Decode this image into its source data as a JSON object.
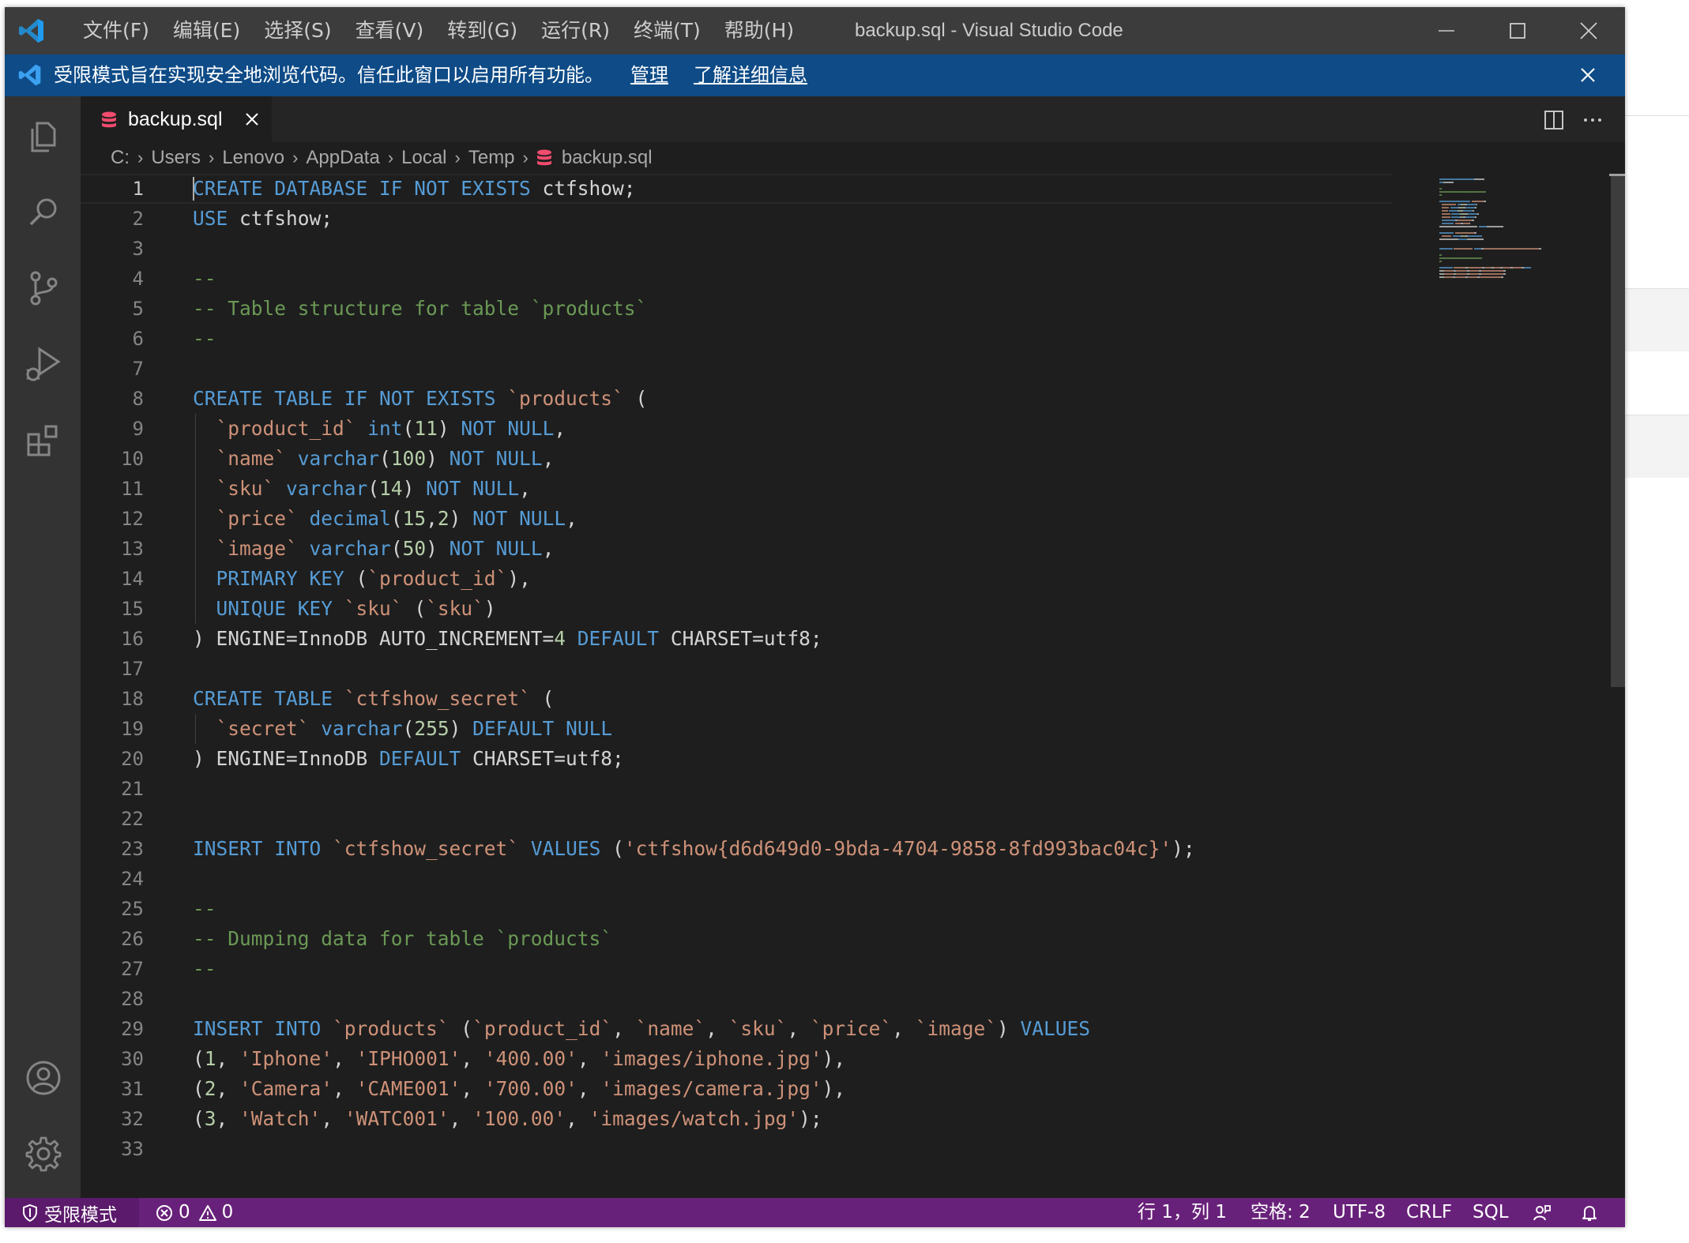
{
  "window": {
    "title": "backup.sql - Visual Studio Code",
    "menu": [
      "文件(F)",
      "编辑(E)",
      "选择(S)",
      "查看(V)",
      "转到(G)",
      "运行(R)",
      "终端(T)",
      "帮助(H)"
    ]
  },
  "banner": {
    "text": "受限模式旨在实现安全地浏览代码。信任此窗口以启用所有功能。",
    "manage_link": "管理",
    "learn_more_link": "了解详细信息"
  },
  "activity_bar": {
    "icons": [
      "explorer-icon",
      "search-icon",
      "source-control-icon",
      "run-debug-icon",
      "extensions-icon",
      "accounts-icon",
      "settings-gear-icon"
    ]
  },
  "tab": {
    "label": "backup.sql"
  },
  "breadcrumb": [
    "C:",
    "Users",
    "Lenovo",
    "AppData",
    "Local",
    "Temp",
    "backup.sql"
  ],
  "editor": {
    "line_numbers": [
      "1",
      "2",
      "3",
      "4",
      "5",
      "6",
      "7",
      "8",
      "9",
      "10",
      "11",
      "12",
      "13",
      "14",
      "15",
      "16",
      "17",
      "18",
      "19",
      "20",
      "21",
      "22",
      "23",
      "24",
      "25",
      "26",
      "27",
      "28",
      "29",
      "30",
      "31",
      "32",
      "33"
    ],
    "lines": [
      [
        [
          "kw",
          "CREATE DATABASE IF NOT EXISTS"
        ],
        [
          "tx",
          " ctfshow;"
        ]
      ],
      [
        [
          "kw",
          "USE"
        ],
        [
          "tx",
          " ctfshow;"
        ]
      ],
      [],
      [
        [
          "cm",
          "--"
        ]
      ],
      [
        [
          "cm",
          "-- Table structure for table `products`"
        ]
      ],
      [
        [
          "cm",
          "--"
        ]
      ],
      [],
      [
        [
          "kw",
          "CREATE TABLE IF NOT EXISTS"
        ],
        [
          "tx",
          " "
        ],
        [
          "str",
          "`products`"
        ],
        [
          "tx",
          " ("
        ]
      ],
      [
        [
          "tx",
          "  "
        ],
        [
          "str",
          "`product_id`"
        ],
        [
          "tx",
          " "
        ],
        [
          "kw",
          "int"
        ],
        [
          "tx",
          "("
        ],
        [
          "num",
          "11"
        ],
        [
          "tx",
          ") "
        ],
        [
          "kw",
          "NOT NULL"
        ],
        [
          "tx",
          ","
        ]
      ],
      [
        [
          "tx",
          "  "
        ],
        [
          "str",
          "`name`"
        ],
        [
          "tx",
          " "
        ],
        [
          "kw",
          "varchar"
        ],
        [
          "tx",
          "("
        ],
        [
          "num",
          "100"
        ],
        [
          "tx",
          ") "
        ],
        [
          "kw",
          "NOT NULL"
        ],
        [
          "tx",
          ","
        ]
      ],
      [
        [
          "tx",
          "  "
        ],
        [
          "str",
          "`sku`"
        ],
        [
          "tx",
          " "
        ],
        [
          "kw",
          "varchar"
        ],
        [
          "tx",
          "("
        ],
        [
          "num",
          "14"
        ],
        [
          "tx",
          ") "
        ],
        [
          "kw",
          "NOT NULL"
        ],
        [
          "tx",
          ","
        ]
      ],
      [
        [
          "tx",
          "  "
        ],
        [
          "str",
          "`price`"
        ],
        [
          "tx",
          " "
        ],
        [
          "kw",
          "decimal"
        ],
        [
          "tx",
          "("
        ],
        [
          "num",
          "15"
        ],
        [
          "tx",
          ","
        ],
        [
          "num",
          "2"
        ],
        [
          "tx",
          ") "
        ],
        [
          "kw",
          "NOT NULL"
        ],
        [
          "tx",
          ","
        ]
      ],
      [
        [
          "tx",
          "  "
        ],
        [
          "str",
          "`image`"
        ],
        [
          "tx",
          " "
        ],
        [
          "kw",
          "varchar"
        ],
        [
          "tx",
          "("
        ],
        [
          "num",
          "50"
        ],
        [
          "tx",
          ") "
        ],
        [
          "kw",
          "NOT NULL"
        ],
        [
          "tx",
          ","
        ]
      ],
      [
        [
          "tx",
          "  "
        ],
        [
          "kw",
          "PRIMARY KEY"
        ],
        [
          "tx",
          " ("
        ],
        [
          "str",
          "`product_id`"
        ],
        [
          "tx",
          "),"
        ]
      ],
      [
        [
          "tx",
          "  "
        ],
        [
          "kw",
          "UNIQUE KEY"
        ],
        [
          "tx",
          " "
        ],
        [
          "str",
          "`sku`"
        ],
        [
          "tx",
          " ("
        ],
        [
          "str",
          "`sku`"
        ],
        [
          "tx",
          ")"
        ]
      ],
      [
        [
          "tx",
          ") ENGINE=InnoDB AUTO_INCREMENT="
        ],
        [
          "num",
          "4"
        ],
        [
          "tx",
          " "
        ],
        [
          "kw",
          "DEFAULT"
        ],
        [
          "tx",
          " CHARSET=utf8;"
        ]
      ],
      [],
      [
        [
          "kw",
          "CREATE TABLE"
        ],
        [
          "tx",
          " "
        ],
        [
          "str",
          "`ctfshow_secret`"
        ],
        [
          "tx",
          " ("
        ]
      ],
      [
        [
          "tx",
          "  "
        ],
        [
          "str",
          "`secret`"
        ],
        [
          "tx",
          " "
        ],
        [
          "kw",
          "varchar"
        ],
        [
          "tx",
          "("
        ],
        [
          "num",
          "255"
        ],
        [
          "tx",
          ") "
        ],
        [
          "kw",
          "DEFAULT NULL"
        ]
      ],
      [
        [
          "tx",
          ") ENGINE=InnoDB "
        ],
        [
          "kw",
          "DEFAULT"
        ],
        [
          "tx",
          " CHARSET=utf8;"
        ]
      ],
      [],
      [],
      [
        [
          "kw",
          "INSERT INTO"
        ],
        [
          "tx",
          " "
        ],
        [
          "str",
          "`ctfshow_secret`"
        ],
        [
          "tx",
          " "
        ],
        [
          "kw",
          "VALUES"
        ],
        [
          "tx",
          " ("
        ],
        [
          "str",
          "'ctfshow{d6d649d0-9bda-4704-9858-8fd993bac04c}'"
        ],
        [
          "tx",
          ");"
        ]
      ],
      [],
      [
        [
          "cm",
          "--"
        ]
      ],
      [
        [
          "cm",
          "-- Dumping data for table `products`"
        ]
      ],
      [
        [
          "cm",
          "--"
        ]
      ],
      [],
      [
        [
          "kw",
          "INSERT INTO"
        ],
        [
          "tx",
          " "
        ],
        [
          "str",
          "`products`"
        ],
        [
          "tx",
          " ("
        ],
        [
          "str",
          "`product_id`"
        ],
        [
          "tx",
          ", "
        ],
        [
          "str",
          "`name`"
        ],
        [
          "tx",
          ", "
        ],
        [
          "str",
          "`sku`"
        ],
        [
          "tx",
          ", "
        ],
        [
          "str",
          "`price`"
        ],
        [
          "tx",
          ", "
        ],
        [
          "str",
          "`image`"
        ],
        [
          "tx",
          ") "
        ],
        [
          "kw",
          "VALUES"
        ]
      ],
      [
        [
          "tx",
          "("
        ],
        [
          "num",
          "1"
        ],
        [
          "tx",
          ", "
        ],
        [
          "str",
          "'Iphone'"
        ],
        [
          "tx",
          ", "
        ],
        [
          "str",
          "'IPHO001'"
        ],
        [
          "tx",
          ", "
        ],
        [
          "str",
          "'400.00'"
        ],
        [
          "tx",
          ", "
        ],
        [
          "str",
          "'images/iphone.jpg'"
        ],
        [
          "tx",
          "),"
        ]
      ],
      [
        [
          "tx",
          "("
        ],
        [
          "num",
          "2"
        ],
        [
          "tx",
          ", "
        ],
        [
          "str",
          "'Camera'"
        ],
        [
          "tx",
          ", "
        ],
        [
          "str",
          "'CAME001'"
        ],
        [
          "tx",
          ", "
        ],
        [
          "str",
          "'700.00'"
        ],
        [
          "tx",
          ", "
        ],
        [
          "str",
          "'images/camera.jpg'"
        ],
        [
          "tx",
          "),"
        ]
      ],
      [
        [
          "tx",
          "("
        ],
        [
          "num",
          "3"
        ],
        [
          "tx",
          ", "
        ],
        [
          "str",
          "'Watch'"
        ],
        [
          "tx",
          ", "
        ],
        [
          "str",
          "'WATC001'"
        ],
        [
          "tx",
          ", "
        ],
        [
          "str",
          "'100.00'"
        ],
        [
          "tx",
          ", "
        ],
        [
          "str",
          "'images/watch.jpg'"
        ],
        [
          "tx",
          ");"
        ]
      ],
      []
    ]
  },
  "status_bar": {
    "restricted_mode": "受限模式",
    "errors": "0",
    "warnings": "0",
    "cursor_position": "行 1，列 1",
    "indentation": "空格: 2",
    "encoding": "UTF-8",
    "eol": "CRLF",
    "language": "SQL"
  },
  "colors": {
    "keyword": "#569cd6",
    "string": "#ce9178",
    "number": "#b5cea8",
    "comment": "#6a9955",
    "text": "#d4d4d4",
    "status_bar": "#68217a",
    "banner": "#0e4b87",
    "db_icon": "#f14c6e"
  }
}
